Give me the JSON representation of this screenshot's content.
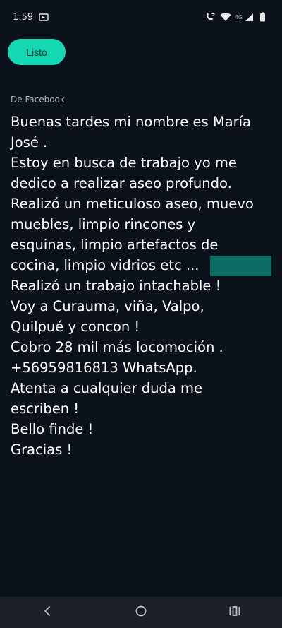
{
  "status_bar": {
    "time": "1:59",
    "network": "4G"
  },
  "header": {
    "done_label": "Listo"
  },
  "source": {
    "label": "De Facebook"
  },
  "message": {
    "lines": [
      "Buenas tardes mi nombre es María",
      "José .",
      "Estoy en busca de trabajo yo me",
      "dedico a realizar aseo profundo.",
      "Realizó un meticuloso aseo, muevo",
      "muebles, limpio rincones y",
      "esquinas, limpio artefactos de",
      "cocina, limpio vidrios etc ...",
      "Realizó un trabajo intachable !",
      "Voy a Curauma, viña, Valpo,",
      "Quilpué y concon !",
      "Cobro 28 mil más locomoción .",
      "+56959816813 WhatsApp.",
      "Atenta a cualquier duda me",
      "escriben !",
      "Bello finde !",
      "Gracias !"
    ]
  },
  "colors": {
    "background": "#0b121b",
    "accent": "#14d9b3",
    "redaction": "#0c6b63",
    "nav_bar": "#1c2129"
  },
  "icons": {
    "status_left": "cast-icon",
    "status_right": [
      "wifi-calling-icon",
      "wifi-icon",
      "signal-icon",
      "battery-icon"
    ],
    "nav": [
      "back-icon",
      "home-icon",
      "recents-icon"
    ]
  }
}
